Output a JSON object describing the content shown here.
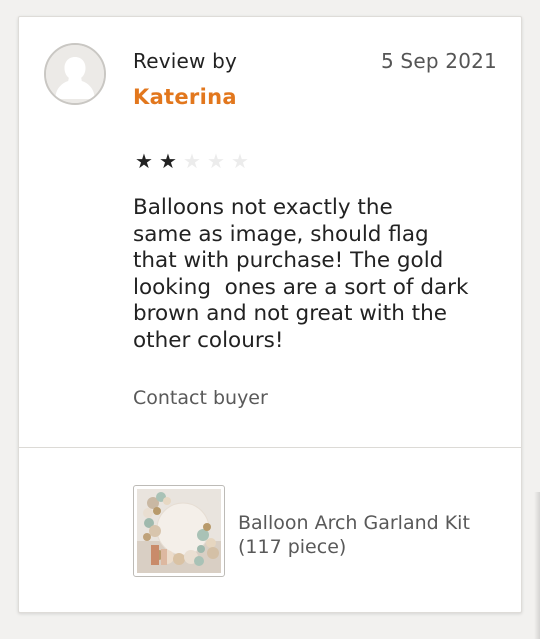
{
  "review": {
    "header_label": "Review by",
    "reviewer_name": "Katerina",
    "date": "5 Sep 2021",
    "rating": 2,
    "max_rating": 5,
    "text": "Balloons not exactly the\nsame as image, should flag\nthat with purchase! The gold\nlooking  ones are a sort of dark\nbrown and not great with the\nother colours!",
    "contact_label": "Contact buyer"
  },
  "product": {
    "name": "Balloon Arch Garland Kit (117 piece)"
  },
  "icons": {
    "avatar": "default-user-avatar-icon",
    "star": "star-icon"
  },
  "colors": {
    "accent": "#e2771d",
    "star_filled": "#222222",
    "star_empty": "#ececec"
  }
}
